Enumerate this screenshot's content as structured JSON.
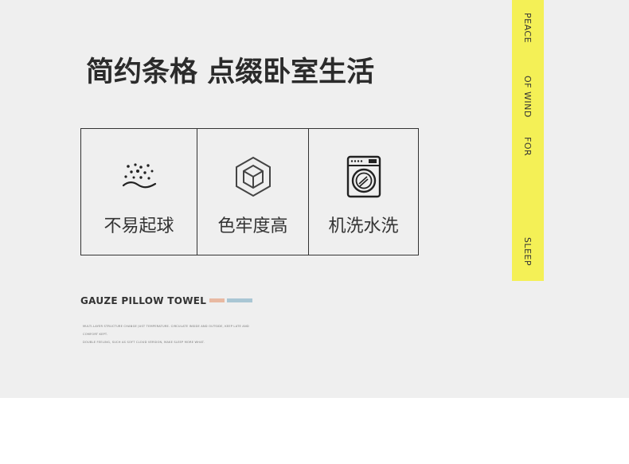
{
  "headline": "简约条格 点缀卧室生活",
  "features": [
    {
      "icon": "pilling-dots-icon",
      "label": "不易起球"
    },
    {
      "icon": "cube-icon",
      "label": "色牢度高"
    },
    {
      "icon": "washing-machine-icon",
      "label": "机洗水洗"
    }
  ],
  "product_title": "GAUZE PILLOW TOWEL",
  "swatch_colors": [
    "#e8b9a2",
    "#a9c6d4"
  ],
  "fine_print": [
    "MULTI-LAYER STRUCTURE CHANGE JUST TEMPERATURE. CIRCULATE INSIDE AND OUTSIDE, KEEP LATE AND",
    "COMFORT KEPT.",
    "DOUBLE FEELING, SUCH AS SOFT CLOUD VERSION, MAKE SLEEP MORE WHAT."
  ],
  "ribbon": {
    "color": "#f4f056",
    "words": [
      "PEACE",
      "OF WIND",
      "FOR",
      "SLEEP"
    ]
  }
}
